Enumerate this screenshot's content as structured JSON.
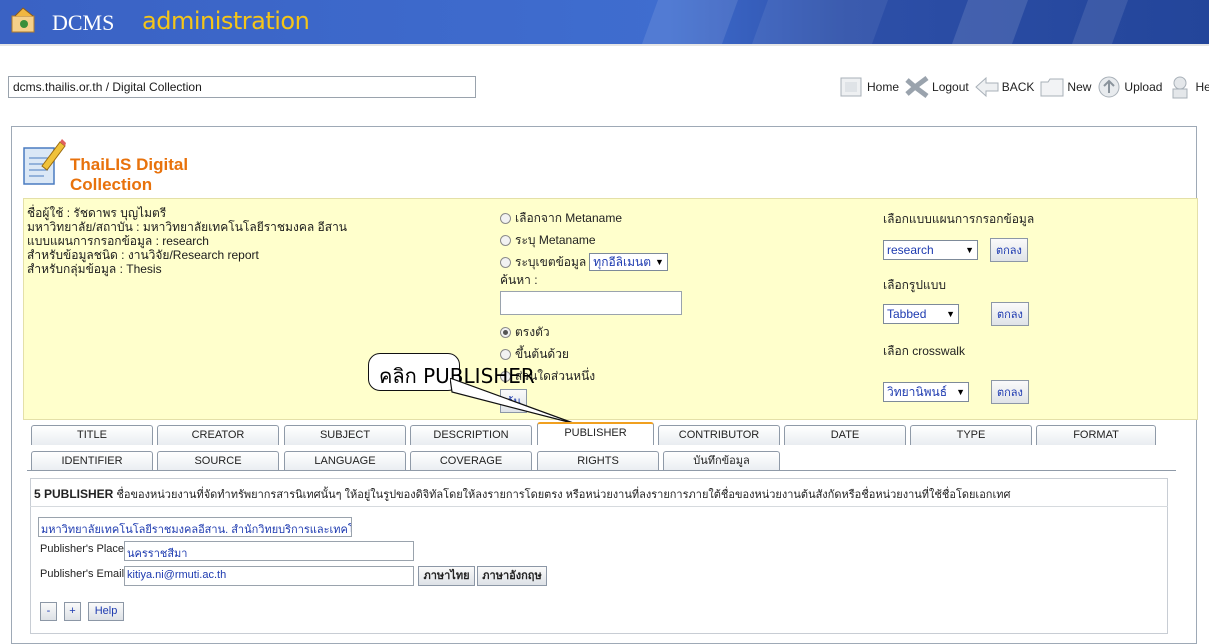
{
  "banner": {
    "brand": "DCMS",
    "subtitle": "administration"
  },
  "address": {
    "host": "dcms.thailis.or.th",
    "path": " / Digital Collection"
  },
  "toolbar": [
    {
      "label": "Home",
      "icon": "home-icon"
    },
    {
      "label": "Logout",
      "icon": "logout-icon"
    },
    {
      "label": "BACK",
      "icon": "back-icon"
    },
    {
      "label": "New",
      "icon": "new-folder-icon"
    },
    {
      "label": "Upload",
      "icon": "upload-icon"
    },
    {
      "label": "Help",
      "icon": "help-icon"
    }
  ],
  "brand": {
    "title": "ThaiLIS Digital Collection"
  },
  "info": {
    "line1": "ชื่อผู้ใช้ : รัชดาพร บุญไมตรี",
    "line2": "มหาวิทยาลัย/สถาบัน : มหาวิทยาลัยเทคโนโลยีราชมงคล อีสาน",
    "line3": "แบบแผนการกรอกข้อมูล : research",
    "line4": "สำหรับข้อมูลชนิด : งานวิจัย/Research report",
    "line5": "สำหรับกลุ่มข้อมูล : Thesis"
  },
  "search": {
    "opt_metaname": "เลือกจาก Metaname",
    "opt_specify": "ระบุ Metaname",
    "opt_scope": "ระบุเขตข้อมูล",
    "scope_value": "ทุกอีลิเมนต",
    "find_label": "ค้นหา :",
    "find_value": "",
    "match_exact": "ตรงตัว",
    "match_start": "ขึ้นต้นด้วย",
    "match_part": "ส่วนใดส่วนหนึ่ง",
    "button": "ค้น"
  },
  "settings": {
    "schema_label": "เลือกแบบแผนการกรอกข้อมูล",
    "schema_value": "research",
    "format_label": "เลือกรูปแบบ",
    "format_value": "Tabbed",
    "crosswalk_label": "เลือก crosswalk",
    "crosswalk_value": "วิทยานิพนธ์",
    "ok": "ตกลง"
  },
  "callout": "คลิก PUBLISHER",
  "tabs_row1": [
    "TITLE",
    "CREATOR",
    "SUBJECT",
    "DESCRIPTION",
    "PUBLISHER",
    "CONTRIBUTOR",
    "DATE",
    "TYPE",
    "FORMAT"
  ],
  "tabs_row2": [
    "IDENTIFIER",
    "SOURCE",
    "LANGUAGE",
    "COVERAGE",
    "RIGHTS",
    "บันทึกข้อมูล"
  ],
  "active_tab": "PUBLISHER",
  "publisher": {
    "heading_num": "5 PUBLISHER",
    "heading_desc": "ชื่อของหน่วยงานที่จัดทำทรัพยากรสารนิเทศนั้นๆ ให้อยู่ในรูปของดิจิทัลโดยให้ลงรายการโดยตรง หรือหน่วยงานที่ลงรายการภายใต้ชื่อของหน่วยงานต้นสังกัดหรือชื่อหน่วยงานที่ใช้ชื่อโดยเอกเทศ",
    "name_value": "มหาวิทยาลัยเทคโนโลยีราชมงคลอีสาน. สำนักวิทยบริการและเทคโนโลยีสารสนเทศ",
    "place_label": "Publisher's Place",
    "place_value": "นครราชสีมา",
    "email_label": "Publisher's Email",
    "email_value": "kitiya.ni@rmuti.ac.th",
    "lang_thai": "ภาษาไทย",
    "lang_eng": "ภาษาอังกฤษ",
    "minus": "-",
    "plus": "+",
    "help": "Help"
  },
  "colors": {
    "banner": "#3f6dcf",
    "accent": "#e8720c",
    "yellow": "#ffffcc",
    "link": "#1d3ab0"
  }
}
